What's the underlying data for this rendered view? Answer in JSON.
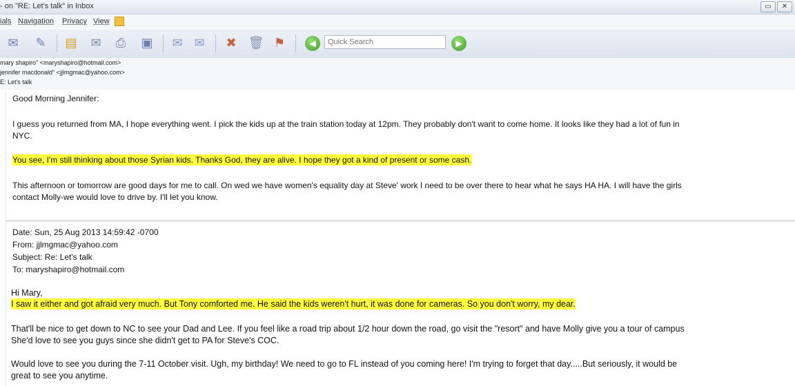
{
  "window": {
    "title": "- on \"RE: Let's talk\" in Inbox",
    "restore": "▭",
    "close": "✕"
  },
  "menu": [
    "ials",
    "Navigation",
    "Privacy",
    "View"
  ],
  "search": {
    "placeholder": "Quick Search"
  },
  "header": {
    "from": "mary shapiro\" <maryshapiro@hotmail.com>",
    "to": "jennifer macdonald\" <jjlmgmac@yahoo.com>",
    "subject": "E: Let's talk"
  },
  "reply": {
    "greeting": "Good Morning Jennifer:",
    "p1_line1": "I guess you returned from MA, I hope everything went.  I pick the kids up at the train station today at 12pm.  They probably don't want to come home.  It looks like they had a lot of fun in",
    "p1_line2": "NYC.",
    "highlight1": "You see, I'm still thinking about those Syrian kids. Thanks God, they are alive. I hope they got a kind of present or some cash.",
    "p2_line1": "This afternoon or tomorrow are good days for me to call.  On wed we have women's equality day at Steve' work I need to be over there to hear what he says HA HA.  I will have the girls",
    "p2_line2": "contact Molly-we would love to drive by.  I'll let you know."
  },
  "quoted": {
    "date": "Date: Sun, 25 Aug 2013 14:59:42 -0700",
    "from": "From: jjlmgmac@yahoo.com",
    "subject": "Subject: Re: Let's talk",
    "to": "To: maryshapiro@hotmail.com",
    "greeting": "Hi Mary,",
    "highlight2": "I saw it either and got afraid very much. But Tony comforted me. He said the kids weren't hurt, it was done for cameras. So you don't worry, my dear.",
    "p1_line1": "That'll be nice to get down to NC to see your Dad and Lee.  If you feel like a road trip about 1/2 hour down the road, go visit the \"resort\" and have Molly give you a tour of campus",
    "p1_line2": "She'd love to see you guys since she didn't get to PA for Steve's COC.",
    "p2_line1": "Would love to see you during the 7-11 October visit.  Ugh, my birthday!  We need to go to FL instead of you coming here!  I'm trying to forget that day.....But seriously, it would be",
    "p2_line2": "great to see you anytime."
  },
  "colors": {
    "highlight": "#ffff3c",
    "toolbar": "#dde3ee",
    "go_button": "#3c9a2a"
  },
  "icons": [
    "write-icon",
    "address-book-icon",
    "reply-icon",
    "read-icon",
    "print-icon",
    "save-icon",
    "forward-icon",
    "forward-all-icon",
    "junk-icon",
    "delete-icon",
    "tag-icon",
    "back-icon",
    "go-icon"
  ]
}
